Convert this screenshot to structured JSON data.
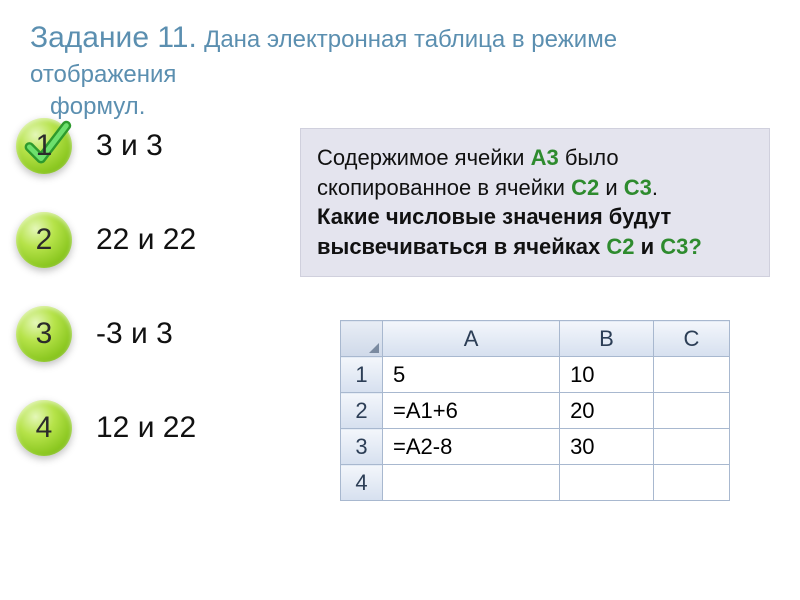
{
  "header": {
    "title_main": "Задание 11.",
    "title_sub": "Дана электронная таблица в режиме отображения",
    "title_sub2": "формул."
  },
  "options": [
    {
      "num": "1",
      "text": "3 и 3",
      "correct": true
    },
    {
      "num": "2",
      "text": "22 и 22",
      "correct": false
    },
    {
      "num": "3",
      "text": "-3 и 3",
      "correct": false
    },
    {
      "num": "4",
      "text": "12 и 22",
      "correct": false
    }
  ],
  "explain": {
    "part1": "Содержимое ячейки ",
    "a3": "А3",
    "part2": " было скопированное в ячейки ",
    "c2": "С2",
    "part3": " и ",
    "c3": "С3",
    "part4": ".",
    "bold_q1": "Какие числовые значения будут высвечиваться в ячейках ",
    "bold_c2": "С2",
    "bold_and": " и ",
    "bold_c3": "С3?"
  },
  "sheet": {
    "cols": [
      "A",
      "B",
      "C"
    ],
    "rows": [
      {
        "n": "1",
        "cells": [
          "5",
          "10",
          ""
        ]
      },
      {
        "n": "2",
        "cells": [
          "=A1+6",
          "20",
          ""
        ]
      },
      {
        "n": "3",
        "cells": [
          "=A2-8",
          "30",
          ""
        ]
      },
      {
        "n": "4",
        "cells": [
          "",
          "",
          ""
        ]
      }
    ]
  }
}
